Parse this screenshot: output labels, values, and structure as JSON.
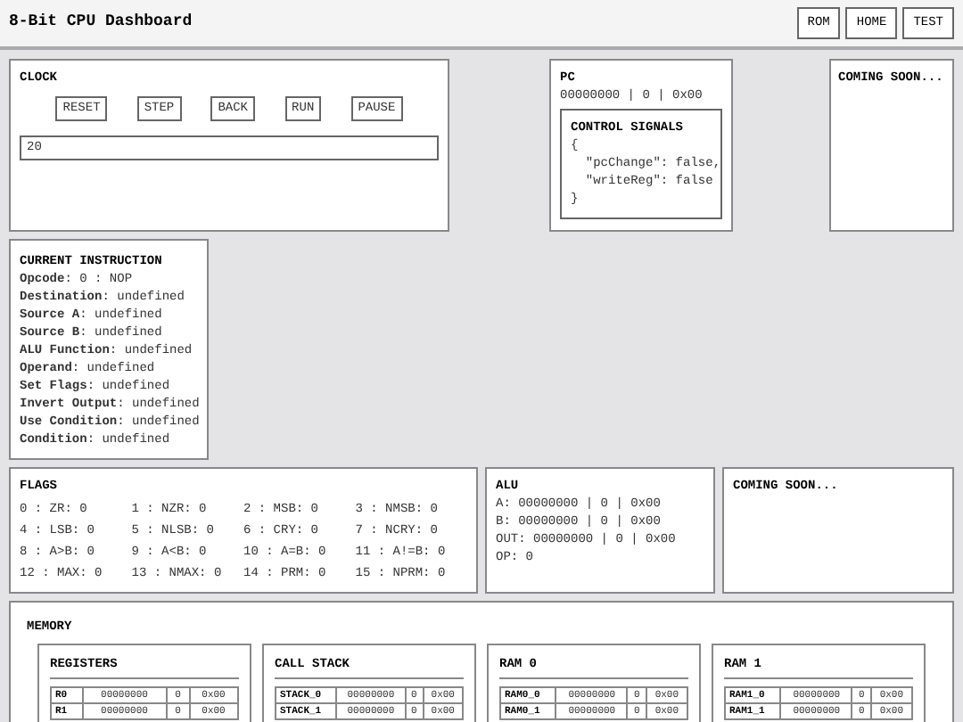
{
  "header": {
    "title": "8-Bit CPU Dashboard",
    "nav_buttons": [
      "ROM",
      "HOME",
      "TEST"
    ]
  },
  "clock": {
    "title": "CLOCK",
    "buttons": [
      "RESET",
      "STEP",
      "BACK",
      "RUN",
      "PAUSE"
    ],
    "value": "20"
  },
  "pc": {
    "title": "PC",
    "value": "00000000 | 0 | 0x00",
    "control_signals": {
      "title": "CONTROL SIGNALS",
      "lines": [
        "{",
        "  \"pcChange\": false,",
        "  \"writeReg\": false",
        "}"
      ]
    }
  },
  "coming_soon_1": {
    "title": "COMING SOON..."
  },
  "current_instruction": {
    "title": "CURRENT INSTRUCTION",
    "fields": [
      {
        "text": "**Opcode**: 0 : NOP"
      },
      {
        "text": "**Destination**: undefined"
      },
      {
        "text": "**Source A**: undefined"
      },
      {
        "text": "**Source B**: undefined"
      },
      {
        "text": "**ALU Function**: undefined"
      },
      {
        "text": "**Operand**: undefined"
      },
      {
        "text": "**Set Flags**: undefined"
      },
      {
        "text": "**Invert Output**: undefined"
      },
      {
        "text": "**Use Condition**: undefined"
      },
      {
        "text": "**Condition**: undefined"
      }
    ]
  },
  "flags": {
    "title": "FLAGS",
    "items": [
      "0 : ZR: 0",
      "1 : NZR: 0",
      "2 : MSB: 0",
      "3 : NMSB: 0",
      "4 : LSB: 0",
      "5 : NLSB: 0",
      "6 : CRY: 0",
      "7 : NCRY: 0",
      "8 : A>B: 0",
      "9 : A<B: 0",
      "10 : A=B: 0",
      "11 : A!=B: 0",
      "12 : MAX: 0",
      "13 : NMAX: 0",
      "14 : PRM: 0",
      "15 : NPRM: 0"
    ]
  },
  "alu": {
    "title": "ALU",
    "lines": [
      "A: 00000000 | 0 | 0x00",
      "B: 00000000 | 0 | 0x00",
      "OUT: 00000000 | 0 | 0x00",
      "OP: 0"
    ]
  },
  "coming_soon_2": {
    "title": "COMING SOON..."
  },
  "memory": {
    "title": "MEMORY",
    "tables": [
      {
        "title": "REGISTERS",
        "rows": [
          [
            "R0",
            "00000000",
            "0",
            "0x00"
          ],
          [
            "R1",
            "00000000",
            "0",
            "0x00"
          ]
        ]
      },
      {
        "title": "CALL STACK",
        "rows": [
          [
            "STACK_0",
            "00000000",
            "0",
            "0x00"
          ],
          [
            "STACK_1",
            "00000000",
            "0",
            "0x00"
          ]
        ]
      },
      {
        "title": "RAM 0",
        "rows": [
          [
            "RAM0_0",
            "00000000",
            "0",
            "0x00"
          ],
          [
            "RAM0_1",
            "00000000",
            "0",
            "0x00"
          ]
        ]
      },
      {
        "title": "RAM 1",
        "rows": [
          [
            "RAM1_0",
            "00000000",
            "0",
            "0x00"
          ],
          [
            "RAM1_1",
            "00000000",
            "0",
            "0x00"
          ]
        ]
      }
    ]
  }
}
